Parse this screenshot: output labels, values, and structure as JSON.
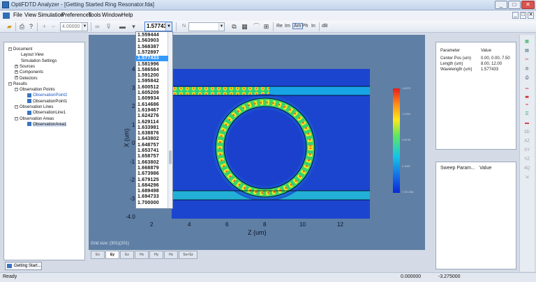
{
  "window": {
    "title": "OptiFDTD Analyzer - [Getting Started Ring Resonator.fda]",
    "controls": [
      "_",
      "□",
      "✕"
    ]
  },
  "menu": [
    "File",
    "View",
    "Simulation",
    "Preferences",
    "Tools",
    "Window",
    "Help"
  ],
  "toolbar": {
    "zoom_value": "4.00000",
    "wavelength_value": "1.577433",
    "combo_n_label": "N",
    "buttons": [
      "Re",
      "Im",
      "Am",
      "Ph",
      "In",
      "dB"
    ]
  },
  "tree": [
    {
      "label": "Document",
      "level": 0,
      "toggle": "−"
    },
    {
      "label": "Layout View",
      "level": 2
    },
    {
      "label": "Simulation Settings",
      "level": 2
    },
    {
      "label": "Sources",
      "level": 1,
      "toggle": "+"
    },
    {
      "label": "Components",
      "level": 1,
      "toggle": "+"
    },
    {
      "label": "Detectors",
      "level": 1,
      "toggle": "+"
    },
    {
      "label": "Results",
      "level": 0,
      "toggle": "−"
    },
    {
      "label": "Observation Points",
      "level": 1,
      "toggle": "−"
    },
    {
      "label": "ObservationPoint2",
      "level": 3,
      "highlight": true
    },
    {
      "label": "ObservationPoint1",
      "level": 3
    },
    {
      "label": "Observation Lines",
      "level": 1,
      "toggle": "−"
    },
    {
      "label": "ObservationLine1",
      "level": 3
    },
    {
      "label": "Observation Areas",
      "level": 1,
      "toggle": "−"
    },
    {
      "label": "ObservationArea1",
      "level": 3,
      "selected": true
    }
  ],
  "doc_tab": "Getting Start...",
  "plot": {
    "x_axis_title": "Z (um)",
    "y_axis_title": "X (um)",
    "x_ticks": [
      "2",
      "4",
      "6",
      "8",
      "10",
      "12"
    ],
    "y_ticks": [
      "4",
      "3",
      "2",
      "1",
      "0",
      "-1",
      "-2",
      "-3",
      "-4.0"
    ],
    "grid_info": "Grid size: (301)(201)",
    "colorbar_labels": [
      "1.6270",
      "1.2202",
      "0.8135",
      "0.4067",
      "7.1E-006"
    ]
  },
  "field_tabs": [
    "Ex",
    "Ey",
    "Ez",
    "Hx",
    "Hy",
    "Hz",
    "Sx+Sz"
  ],
  "active_field_tab": "Ey",
  "wavelength_dropdown": {
    "items": [
      "1.559444",
      "1.563903",
      "1.568387",
      "1.572897",
      "1.577433",
      "1.581996",
      "1.586584",
      "1.591200",
      "1.595842",
      "1.600512",
      "1.605209",
      "1.609934",
      "1.614686",
      "1.619467",
      "1.624276",
      "1.629114",
      "1.633981",
      "1.638876",
      "1.643802",
      "1.648757",
      "1.653741",
      "1.658757",
      "1.663802",
      "1.668879",
      "1.673986",
      "1.679125",
      "1.684296",
      "1.689498",
      "1.694733",
      "1.700000"
    ],
    "selected": "1.577433"
  },
  "parameters": {
    "headers": [
      "Parameter",
      "Value"
    ],
    "rows": [
      {
        "name": "Center Pos (um)",
        "value": "0.00, 0.00, 7.50"
      },
      {
        "name": "Length (um)",
        "value": "8.00, 12.00"
      },
      {
        "name": "Wavelength (um)",
        "value": "1.577433"
      }
    ]
  },
  "sweep": {
    "headers": [
      "Sweep Param...",
      "Value"
    ]
  },
  "right_strip_icons": [
    "grid-icon",
    "layout-icon",
    "tools-icon",
    "target-icon",
    "print-icon",
    "chart-icon",
    "chart2-icon",
    "line-icon",
    "bars-icon",
    "dash-icon",
    "3D",
    "XZ",
    "XY",
    "YZ",
    "4Q",
    "export-icon"
  ],
  "status": {
    "left": "Ready",
    "mid1": "0.000000",
    "mid2": "-3.275000"
  }
}
